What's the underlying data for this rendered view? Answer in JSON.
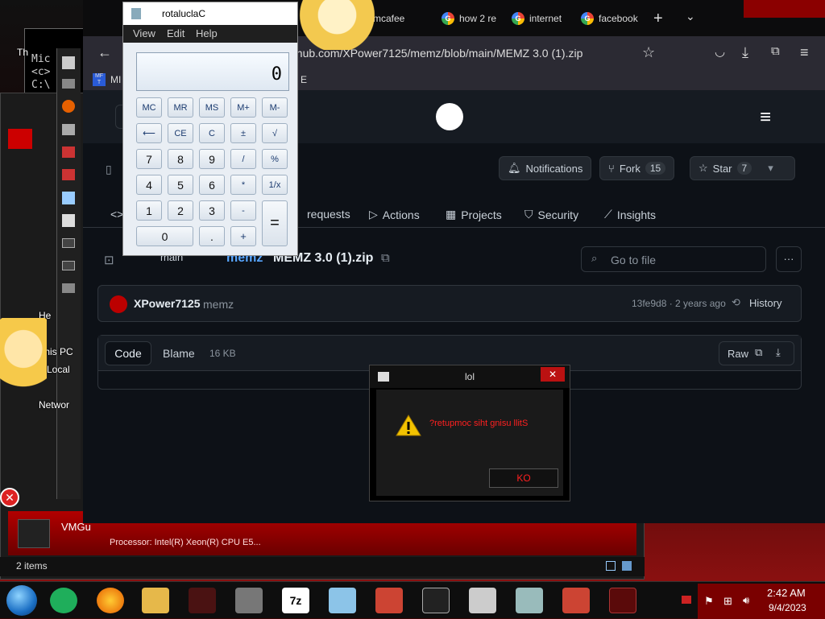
{
  "desktop": {
    "labels": [
      "He",
      "This PC",
      "Local",
      "Networ",
      "VMGu"
    ],
    "explorer_status": "2 items",
    "processor_line": "Processor:   Intel(R) Xeon(R) CPU E5...",
    "cmd_lines": [
      "Mic",
      "<c>",
      "C:\\"
    ],
    "left_label": "Th"
  },
  "browser": {
    "tabs": [
      "mcafee",
      "how 2 re",
      "internet",
      "facebook"
    ],
    "url": "github.com/XPower7125/memz/blob/main/MEMZ 3.0 (1).zip",
    "bookmark_text": "E",
    "bookmark_prefix": "MI"
  },
  "github": {
    "notifications_label": "Notifications",
    "fork_label": "Fork",
    "fork_count": "15",
    "star_label": "Star",
    "star_count": "7",
    "nav": [
      "requests",
      "Actions",
      "Projects",
      "Security",
      "Insights"
    ],
    "branch": "main",
    "breadcrumb_repo": "memz",
    "filename": "MEMZ 3.0 (1).zip",
    "search_placeholder": "Go to file",
    "commit_author": "XPower7125",
    "commit_message": "memz",
    "commit_meta": "13fe9d8 · 2 years ago",
    "history_label": "History",
    "code_tab": "Code",
    "blame_tab": "Blame",
    "file_size": "16 KB",
    "raw_label": "Raw"
  },
  "calculator": {
    "title": "rotaluclaC",
    "menu": [
      "View",
      "Edit",
      "Help"
    ],
    "display": "0",
    "memory_row": [
      "MC",
      "MR",
      "MS",
      "M+",
      "M-"
    ],
    "row2": [
      "⟵",
      "CE",
      "C",
      "±",
      "√"
    ],
    "row3": [
      "7",
      "8",
      "9",
      "/",
      "%"
    ],
    "row4": [
      "4",
      "5",
      "6",
      "*",
      "1/x"
    ],
    "row5": [
      "1",
      "2",
      "3",
      "-"
    ],
    "equals": "=",
    "zero": "0",
    "dot": ".",
    "plus": "+"
  },
  "dialog": {
    "title": "lol",
    "message": "?retupmoc siht gnisu llitS",
    "ok_label": "KO",
    "message_color": "#ff2020"
  },
  "taskbar": {
    "time": "2:42 AM",
    "date": "9/4/2023",
    "icons": [
      "start-orb-icon",
      "notes-icon",
      "firefox-icon",
      "explorer-icon",
      "toolbox-icon",
      "wall-icon",
      "7zip-icon",
      "notepad-icon",
      "toolbox-icon",
      "cmd-icon",
      "window-icon",
      "network-icon",
      "toolbox-icon",
      "calculator-icon"
    ],
    "sevenzip_label": "7z"
  }
}
